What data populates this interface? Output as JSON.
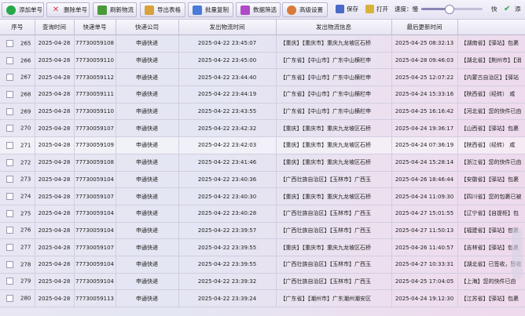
{
  "toolbar": {
    "add_label": "添加单号",
    "delete_label": "删除单号",
    "refresh_label": "刷新物流",
    "export_label": "导出表格",
    "batch_copy_label": "批量复制",
    "filter_label": "数据筛选",
    "advanced_label": "高级设置",
    "save_label": "保存",
    "open_label": "打开",
    "speed_label": "速度：慢",
    "fast_label": "快",
    "extra_label": "添",
    "speed_value": 0.45,
    "colors": {
      "add": "#27a84a",
      "delete": "#d93a3a",
      "refresh": "#4a9a3a",
      "export": "#d9a23a",
      "batch": "#4a7ad9",
      "filter": "#b04ac7",
      "advanced": "#d97a3a",
      "save": "#4a6ac7",
      "open": "#d9b23a"
    }
  },
  "columns": [
    "序号",
    "查询时间",
    "快递单号",
    "快递公司",
    "发出物流时间",
    "发出物流信息",
    "最后更新时间",
    ""
  ],
  "rows": [
    {
      "no": "265",
      "query": "2025-04-28",
      "tracking": "77730059108",
      "company": "申通快递",
      "sent": "2025-04-22 23:45:07",
      "info": "【重庆】【重庆市】重庆九龙坡区石桥",
      "updated": "2025-04-25 08:32:13",
      "latest": "【湖南省】【驿站】包裹"
    },
    {
      "no": "266",
      "query": "2025-04-28",
      "tracking": "77730059110",
      "company": "申通快递",
      "sent": "2025-04-22 23:45:00",
      "info": "【广东省】【中山市】广东中山横栏申",
      "updated": "2025-04-28 09:46:03",
      "latest": "【湖北省】【荆州市】【消"
    },
    {
      "no": "267",
      "query": "2025-04-28",
      "tracking": "77730059112",
      "company": "申通快递",
      "sent": "2025-04-22 23:44:40",
      "info": "【广东省】【中山市】广东中山横栏申",
      "updated": "2025-04-25 12:07:22",
      "latest": "【内蒙古自治区】【驿站"
    },
    {
      "no": "268",
      "query": "2025-04-28",
      "tracking": "77730059111",
      "company": "申通快递",
      "sent": "2025-04-22 23:44:19",
      "info": "【广东省】【中山市】广东中山横栏申",
      "updated": "2025-04-24 15:33:16",
      "latest": "【陕西省】（经转） 咸"
    },
    {
      "no": "269",
      "query": "2025-04-28",
      "tracking": "77730059110",
      "company": "申通快递",
      "sent": "2025-04-22 23:43:55",
      "info": "【广东省】【中山市】广东中山横栏申",
      "updated": "2025-04-25 16:16:42",
      "latest": "【河北省】您的快件已由"
    },
    {
      "no": "270",
      "query": "2025-04-28",
      "tracking": "77730059107",
      "company": "申通快递",
      "sent": "2025-04-22 23:42:32",
      "info": "【重庆】【重庆市】重庆九龙坡区石桥",
      "updated": "2025-04-24 19:36:17",
      "latest": "【山西省】【驿站】包裹"
    },
    {
      "no": "271",
      "query": "2025-04-28",
      "tracking": "77730059109",
      "company": "申通快递",
      "sent": "2025-04-22 23:42:03",
      "info": "【重庆】【重庆市】重庆九龙坡区石桥",
      "updated": "2025-04-24 07:36:19",
      "latest": "【陕西省】（经转） 咸"
    },
    {
      "no": "272",
      "query": "2025-04-28",
      "tracking": "77730059108",
      "company": "申通快递",
      "sent": "2025-04-22 23:41:46",
      "info": "【重庆】【重庆市】重庆九龙坡区石桥",
      "updated": "2025-04-24 15:28:14",
      "latest": "【浙江省】您的快件已由"
    },
    {
      "no": "273",
      "query": "2025-04-28",
      "tracking": "77730059104",
      "company": "申通快递",
      "sent": "2025-04-22 23:40:36",
      "info": "【广西壮族自治区】【玉林市】广西玉",
      "updated": "2025-04-26 18:46:44",
      "latest": "【安徽省】【驿站】包裹"
    },
    {
      "no": "274",
      "query": "2025-04-28",
      "tracking": "77730059107",
      "company": "申通快递",
      "sent": "2025-04-22 23:40:30",
      "info": "【重庆】【重庆市】重庆九龙坡区石桥",
      "updated": "2025-04-24 11:09:30",
      "latest": "【四川省】您的包裹已被"
    },
    {
      "no": "275",
      "query": "2025-04-28",
      "tracking": "77730059104",
      "company": "申通快递",
      "sent": "2025-04-22 23:40:28",
      "info": "【广西壮族自治区】【玉林市】广西玉",
      "updated": "2025-04-27 15:01:55",
      "latest": "【辽宁省】【自提柜】包"
    },
    {
      "no": "276",
      "query": "2025-04-28",
      "tracking": "77730059104",
      "company": "申通快递",
      "sent": "2025-04-22 23:39:57",
      "info": "【广西壮族自治区】【玉林市】广西玉",
      "updated": "2025-04-27 11:50:13",
      "latest": "【福建省】【驿站】包裹"
    },
    {
      "no": "277",
      "query": "2025-04-28",
      "tracking": "77730059107",
      "company": "申通快递",
      "sent": "2025-04-22 23:39:55",
      "info": "【重庆】【重庆市】重庆九龙坡区石桥",
      "updated": "2025-04-26 11:40:57",
      "latest": "【吉林省】【驿站】包裹"
    },
    {
      "no": "278",
      "query": "2025-04-28",
      "tracking": "77730059104",
      "company": "申通快递",
      "sent": "2025-04-22 23:39:55",
      "info": "【广西壮族自治区】【玉林市】广西玉",
      "updated": "2025-04-27 10:33:31",
      "latest": "【湖北省】已签收，签收"
    },
    {
      "no": "279",
      "query": "2025-04-28",
      "tracking": "77730059104",
      "company": "申通快递",
      "sent": "2025-04-22 23:39:32",
      "info": "【广西壮族自治区】【玉林市】广西玉",
      "updated": "2025-04-25 17:04:05",
      "latest": "【上海】您的快件已由"
    },
    {
      "no": "280",
      "query": "2025-04-28",
      "tracking": "77730059113",
      "company": "申通快递",
      "sent": "2025-04-22 23:39:24",
      "info": "【广东省】【潮州市】广东潮州潮安区",
      "updated": "2025-04-24 19:12:30",
      "latest": "【江苏省】【驿站】包裹"
    }
  ]
}
